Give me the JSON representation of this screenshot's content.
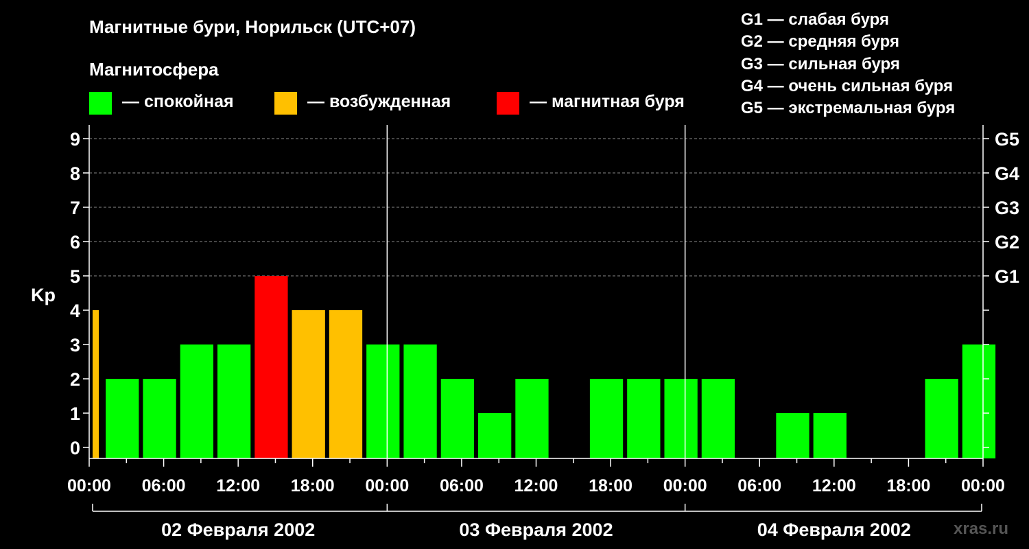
{
  "header": {
    "title": "Магнитные бури, Норильск (UTC+07)",
    "legend_title": "Магнитосфера",
    "legend": [
      {
        "label": "— спокойная",
        "color": "#00ff00"
      },
      {
        "label": "— возбужденная",
        "color": "#ffc000"
      },
      {
        "label": "— магнитная буря",
        "color": "#ff0000"
      }
    ],
    "g_scale": [
      "G1 — слабая буря",
      "G2 — средняя буря",
      "G3 — сильная буря",
      "G4 — очень сильная буря",
      "G5 — экстремальная буря"
    ]
  },
  "watermark": "xras.ru",
  "chart_data": {
    "type": "bar",
    "ylabel": "Kp",
    "ylim": [
      0,
      9
    ],
    "yticks": [
      "0",
      "1",
      "2",
      "3",
      "4",
      "5",
      "6",
      "7",
      "8",
      "9"
    ],
    "right_ticks": [
      {
        "value": 5,
        "label": "G1"
      },
      {
        "value": 6,
        "label": "G2"
      },
      {
        "value": 7,
        "label": "G3"
      },
      {
        "value": 8,
        "label": "G4"
      },
      {
        "value": 9,
        "label": "G5"
      }
    ],
    "xlim_hours": [
      0,
      72
    ],
    "xtick_labels": [
      "00:00",
      "06:00",
      "12:00",
      "18:00",
      "00:00",
      "06:00",
      "12:00",
      "18:00",
      "00:00",
      "06:00",
      "12:00",
      "18:00",
      "00:00"
    ],
    "days": [
      "02 Февраля 2002",
      "03 Февраля 2002",
      "04 Февраля 2002"
    ],
    "grid": "dashed horizontal at Kp 5-9",
    "colors": {
      "quiet": "#00ff00",
      "active": "#ffc000",
      "storm": "#ff0000"
    },
    "bars": [
      {
        "start_hour": 0,
        "value": 4
      },
      {
        "start_hour": 1,
        "value": 2
      },
      {
        "start_hour": 4,
        "value": 2
      },
      {
        "start_hour": 7,
        "value": 3
      },
      {
        "start_hour": 10,
        "value": 3
      },
      {
        "start_hour": 13,
        "value": 5
      },
      {
        "start_hour": 16,
        "value": 4
      },
      {
        "start_hour": 19,
        "value": 4
      },
      {
        "start_hour": 22,
        "value": 3
      },
      {
        "start_hour": 25,
        "value": 3
      },
      {
        "start_hour": 28,
        "value": 2
      },
      {
        "start_hour": 31,
        "value": 1
      },
      {
        "start_hour": 34,
        "value": 2
      },
      {
        "start_hour": 37,
        "value": 0
      },
      {
        "start_hour": 40,
        "value": 2
      },
      {
        "start_hour": 43,
        "value": 2
      },
      {
        "start_hour": 46,
        "value": 2
      },
      {
        "start_hour": 49,
        "value": 2
      },
      {
        "start_hour": 52,
        "value": 0
      },
      {
        "start_hour": 55,
        "value": 1
      },
      {
        "start_hour": 58,
        "value": 1
      },
      {
        "start_hour": 61,
        "value": 0
      },
      {
        "start_hour": 64,
        "value": 0
      },
      {
        "start_hour": 67,
        "value": 2
      },
      {
        "start_hour": 70,
        "value": 3
      }
    ]
  }
}
